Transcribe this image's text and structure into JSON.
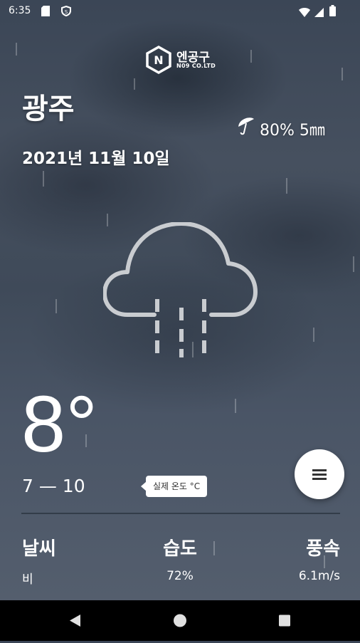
{
  "status_bar": {
    "time": "6:35",
    "icons": [
      "sd-card-icon",
      "sync-shield-icon",
      "wifi-icon",
      "cellular-icon",
      "battery-icon"
    ]
  },
  "brand": {
    "logo_letter": "N",
    "name": "엔공구",
    "subtitle": "N09 CO.LTD"
  },
  "location": {
    "city": "광주",
    "date": "2021년 11월 10일"
  },
  "precipitation": {
    "icon": "umbrella-icon",
    "text": "80% 5㎜"
  },
  "current": {
    "condition_icon": "cloud-rain-icon",
    "temperature": "8°",
    "range": "7 — 10",
    "tooltip": "실제 온도 °C"
  },
  "fab": {
    "icon": "menu-icon"
  },
  "stats": [
    {
      "label": "날씨",
      "value": "비"
    },
    {
      "label": "습도",
      "value": "72%"
    },
    {
      "label": "풍속",
      "value": "6.1m/s"
    }
  ],
  "nav_bar": {
    "buttons": [
      "back-icon",
      "home-icon",
      "recents-icon"
    ]
  },
  "colors": {
    "background": "#46505f",
    "text": "#ffffff",
    "icon_stroke": "#c9ccd0",
    "fab_background": "#ffffff",
    "nav_bar": "#000000"
  }
}
